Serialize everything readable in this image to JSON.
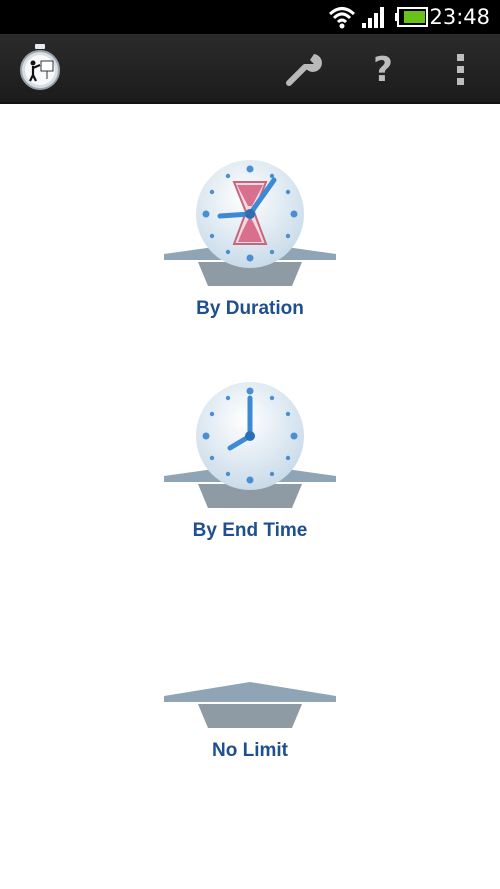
{
  "status_bar": {
    "time": "23:48",
    "icons": [
      "wifi-icon",
      "signal-icon",
      "battery-icon"
    ]
  },
  "action_bar": {
    "app_icon": "stopwatch-presentation-icon",
    "settings_icon": "wrench-icon",
    "help_icon": "question-mark-icon",
    "overflow_icon": "vertical-ellipsis-icon"
  },
  "options": [
    {
      "label": "By Duration",
      "icon": "hourglass-clock-icon"
    },
    {
      "label": "By End Time",
      "icon": "clock-icon"
    },
    {
      "label": "No Limit",
      "icon": "pedestal-icon"
    }
  ],
  "colors": {
    "label_text": "#1f4f8f",
    "action_bar": "#222222",
    "status_bar": "#000000"
  }
}
